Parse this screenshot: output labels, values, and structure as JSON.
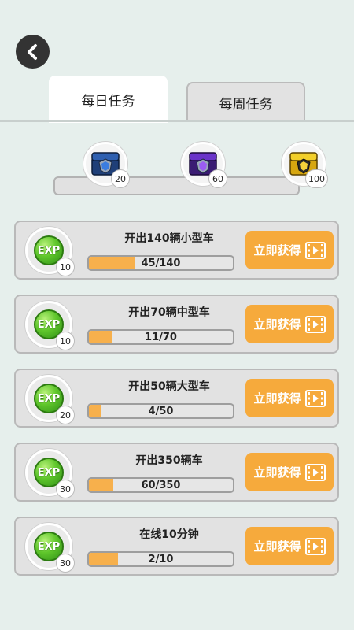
{
  "tabs": {
    "daily": "每日任务",
    "weekly": "每周任务"
  },
  "chests": [
    {
      "points": "20",
      "color": "blue"
    },
    {
      "points": "60",
      "color": "purple"
    },
    {
      "points": "100",
      "color": "gold"
    }
  ],
  "tasks": [
    {
      "title": "开出140辆小型车",
      "exp": "10",
      "progress": "45/140",
      "fraction": 0.321,
      "button": "立即获得"
    },
    {
      "title": "开出70辆中型车",
      "exp": "10",
      "progress": "11/70",
      "fraction": 0.157,
      "button": "立即获得"
    },
    {
      "title": "开出50辆大型车",
      "exp": "20",
      "progress": "4/50",
      "fraction": 0.08,
      "button": "立即获得"
    },
    {
      "title": "开出350辆车",
      "exp": "30",
      "progress": "60/350",
      "fraction": 0.171,
      "button": "立即获得"
    },
    {
      "title": "在线10分钟",
      "exp": "30",
      "progress": "2/10",
      "fraction": 0.2,
      "button": "立即获得"
    }
  ],
  "exp_label": "EXP",
  "colors": {
    "background": "#e6efec",
    "accent": "#f6aa3c",
    "progress_fill": "#f7b04c",
    "exp_green": "#5fc62b"
  },
  "icons": {
    "back": "chevron-left-icon",
    "video": "video-play-icon",
    "chest": "treasure-chest-icon"
  }
}
